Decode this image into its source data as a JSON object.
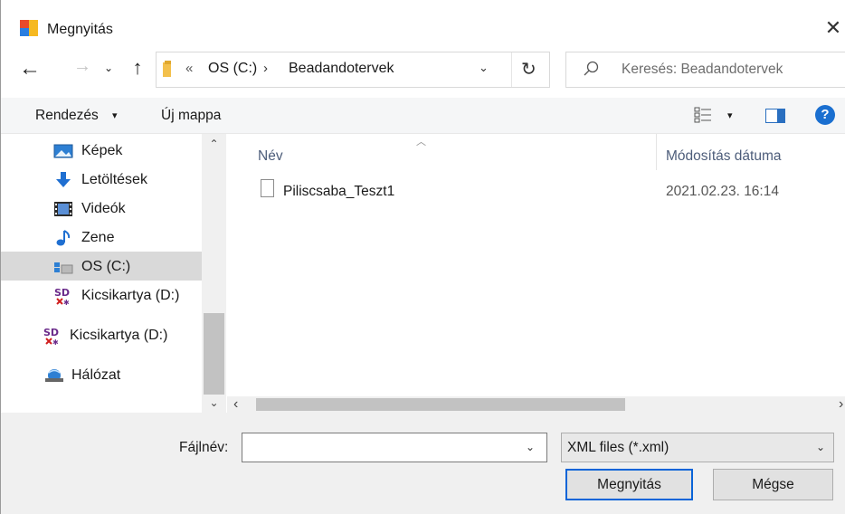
{
  "window": {
    "title": "Megnyitás",
    "close_glyph": "✕"
  },
  "nav": {
    "back": "←",
    "forward": "→",
    "recent": "⌄",
    "up": "↑",
    "address": {
      "overflow": "«",
      "segments": [
        "OS (C:)",
        "Beadandotervek"
      ],
      "separator": "›",
      "dropdown": "⌄",
      "refresh": "↻"
    },
    "search": {
      "placeholder": "Keresés: Beadandotervek"
    }
  },
  "toolbar": {
    "organize": "Rendezés",
    "organize_caret": "▾",
    "new_folder": "Új mappa",
    "view_caret": "▾",
    "help": "?"
  },
  "sidebar": {
    "items": [
      {
        "label": "Képek",
        "icon": "pictures-icon"
      },
      {
        "label": "Letöltések",
        "icon": "downloads-icon"
      },
      {
        "label": "Videók",
        "icon": "videos-icon"
      },
      {
        "label": "Zene",
        "icon": "music-icon"
      },
      {
        "label": "OS (C:)",
        "icon": "drive-icon",
        "selected": true
      },
      {
        "label": "Kicsikartya (D:)",
        "icon": "sd-card-icon"
      },
      {
        "label": "Kicsikartya (D:)",
        "icon": "sd-card-icon"
      },
      {
        "label": "Hálózat",
        "icon": "network-icon"
      }
    ],
    "scroll_up": "⌃",
    "scroll_down": "⌄"
  },
  "filelist": {
    "columns": {
      "name": "Név",
      "date": "Módosítás dátuma",
      "sort_indicator": "︿"
    },
    "rows": [
      {
        "name": "Piliscsaba_Teszt1",
        "date": "2021.02.23. 16:14"
      }
    ],
    "hscroll_left": "‹",
    "hscroll_right": "›"
  },
  "footer": {
    "filename_label": "Fájlnév:",
    "filename_value": "",
    "dropdown": "⌄",
    "filetype": "XML files (*.xml)",
    "open_button": "Megnyitás",
    "cancel_button": "Mégse"
  },
  "colors": {
    "accent": "#0a64d8",
    "help": "#1a6fd0",
    "selected": "#d9d9d9"
  }
}
